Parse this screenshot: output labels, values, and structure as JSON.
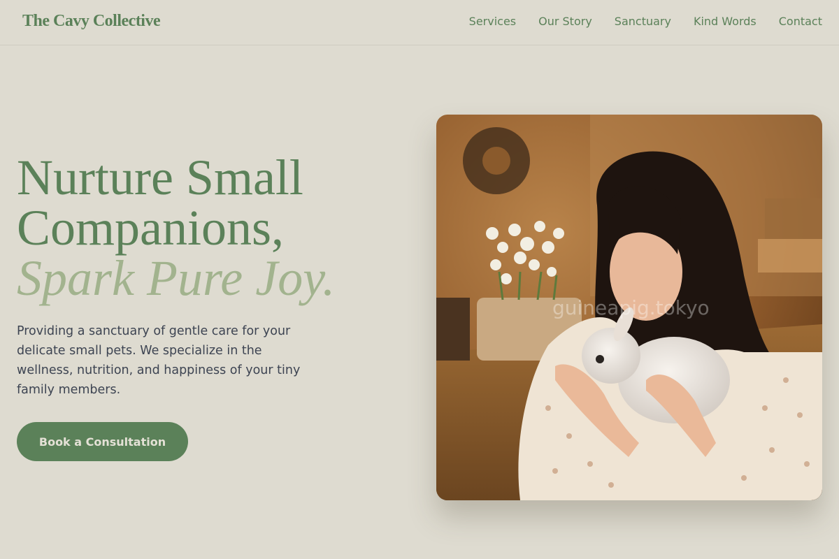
{
  "brand": {
    "name": "The Cavy Collective"
  },
  "nav": {
    "items": [
      {
        "label": "Services"
      },
      {
        "label": "Our Story"
      },
      {
        "label": "Sanctuary"
      },
      {
        "label": "Kind Words"
      },
      {
        "label": "Contact"
      }
    ]
  },
  "hero": {
    "headline_line1": "Nurture Small",
    "headline_line2": "Companions,",
    "headline_accent": "Spark Pure Joy.",
    "description": "Providing a sanctuary of gentle care for your delicate small pets. We specialize in the wellness, nutrition, and happiness of your tiny family members.",
    "cta_label": "Book a Consultation",
    "image_watermark": "guineapig.tokyo"
  },
  "colors": {
    "background": "#dedbd0",
    "primary_green": "#5b8159",
    "accent_sage": "#a2b38e",
    "body_text": "#3d4452"
  }
}
